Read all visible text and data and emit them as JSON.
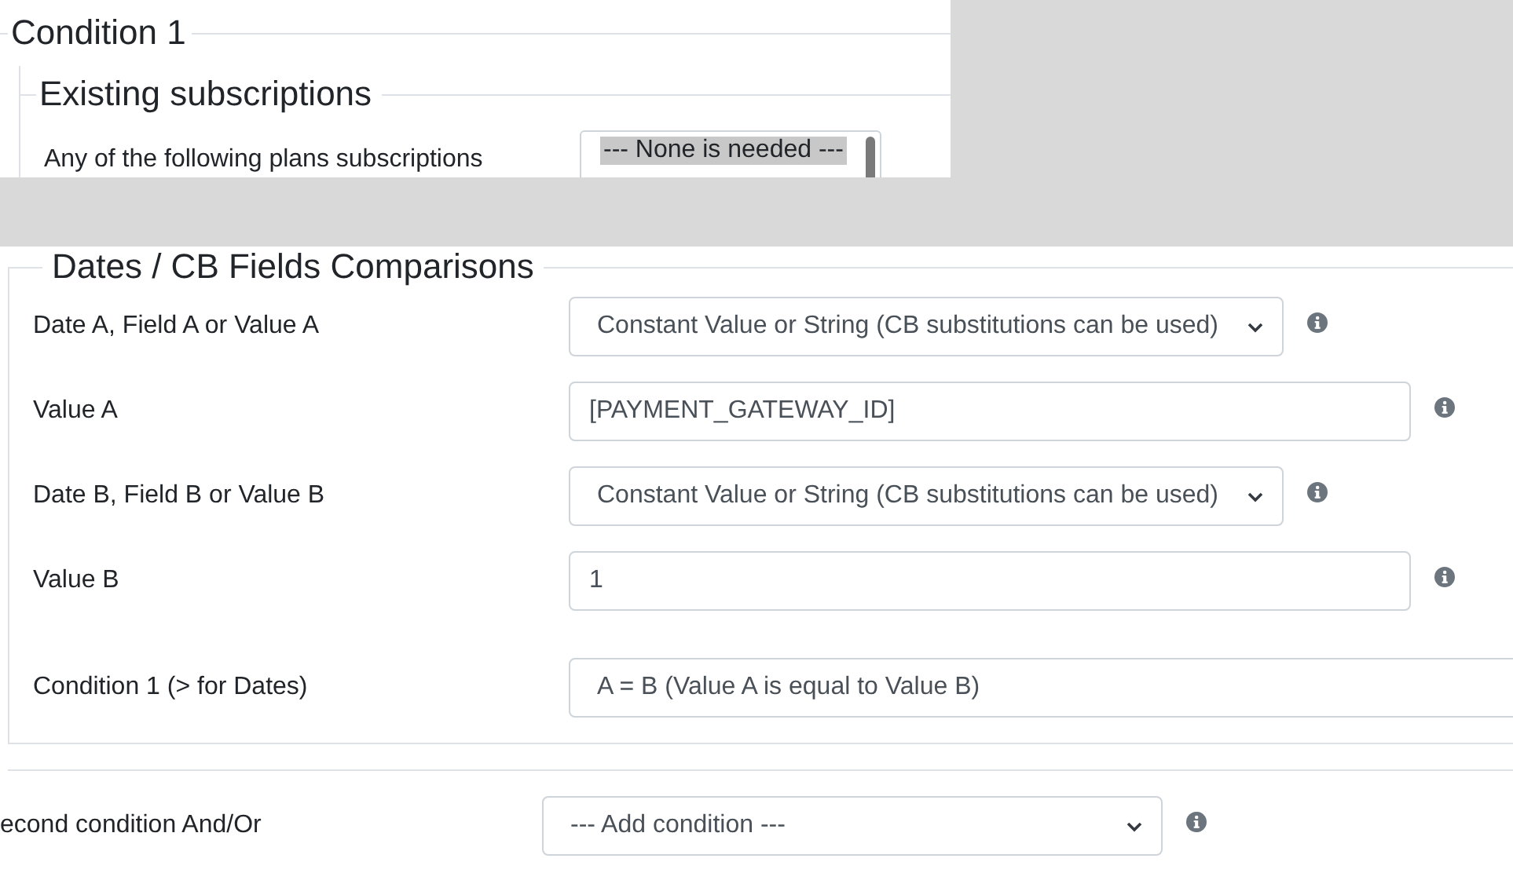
{
  "condition": {
    "legend": "Condition 1",
    "existing_subscriptions": {
      "legend": "Existing subscriptions",
      "label": "Any of the following plans subscriptions",
      "options": [
        {
          "label": "--- None is needed ---",
          "selected": true
        }
      ]
    }
  },
  "comparisons": {
    "legend": "Dates / CB Fields Comparisons",
    "rows": [
      {
        "kind": "select",
        "label": "Date A, Field A or Value A",
        "value": "Constant Value or String (CB substitutions can be used)",
        "info": true
      },
      {
        "kind": "input",
        "label": "Value A",
        "value": "[PAYMENT_GATEWAY_ID]",
        "info": true
      },
      {
        "kind": "select",
        "label": "Date B, Field B or Value B",
        "value": "Constant Value or String (CB substitutions can be used)",
        "info": true
      },
      {
        "kind": "input",
        "label": "Value B",
        "value": "1",
        "info": true
      },
      {
        "kind": "wide-select",
        "label": "Condition 1 (> for Dates)",
        "value": "A = B (Value A is equal to Value B)",
        "info": false
      }
    ]
  },
  "second_condition": {
    "label": "econd condition And/Or",
    "value": "--- Add condition ---",
    "info": true
  }
}
